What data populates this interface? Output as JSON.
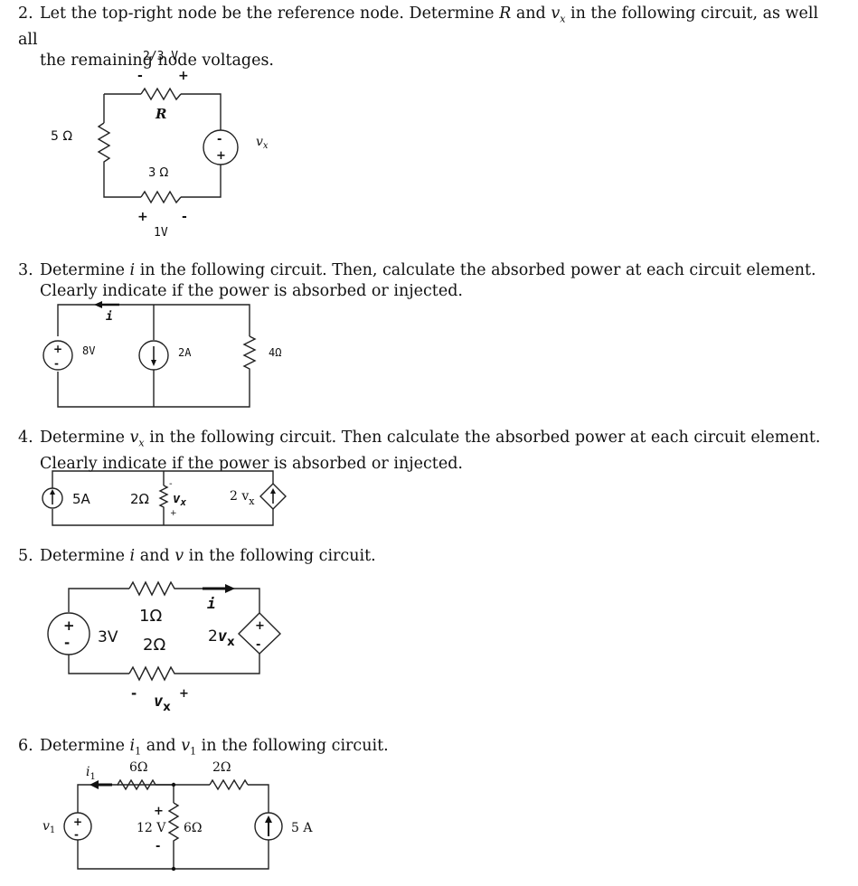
{
  "problems": [
    {
      "number": "2.",
      "line1_a": "Let the top-right node be the reference node. Determine ",
      "line1_R": "R",
      "line1_b": " and ",
      "line1_vx": "v",
      "line1_vx_sub": "x",
      "line1_c": " in the following circuit, as well all",
      "line2": "the remaining node voltages.",
      "circuit": {
        "top_voltage": "2/3 V",
        "top_minus": "-",
        "top_plus": "+",
        "resistor_R": "R",
        "left_resistor": "5 Ω",
        "bottom_resistor": "3 Ω",
        "source_label": "v",
        "source_label_sub": "x",
        "source_top_sign": "-",
        "source_bottom_sign": "+",
        "bottom_plus": "+",
        "bottom_minus": "-",
        "bottom_voltage": "1V"
      }
    },
    {
      "number": "3.",
      "line1_a": "Determine ",
      "line1_i": "i",
      "line1_b": " in the following circuit.  Then, calculate the absorbed power at each circuit element.",
      "line2": "Clearly indicate if the power is absorbed or injected.",
      "circuit": {
        "current_label": "i",
        "voltage_source": "8V",
        "vs_plus": "+",
        "vs_minus": "-",
        "current_source": "2A",
        "resistor": "4Ω"
      }
    },
    {
      "number": "4.",
      "line1_a": "Determine ",
      "line1_vx": "v",
      "line1_vx_sub": "x",
      "line1_b": " in the following circuit.  Then calculate the absorbed power at each circuit element.",
      "line2": "Clearly indicate if the power is absorbed or injected.",
      "circuit": {
        "current_source": "5A",
        "resistor": "2Ω",
        "vx_label": "v",
        "vx_sub": "x",
        "vx_minus": "-",
        "vx_plus": "+",
        "dep_source": "2 v",
        "dep_source_sub": "x"
      }
    },
    {
      "number": "5.",
      "line1_a": "Determine ",
      "line1_i": "i",
      "line1_b": " and ",
      "line1_v": "v",
      "line1_c": " in the following circuit.",
      "circuit": {
        "voltage_source": "3V",
        "vs_plus": "+",
        "vs_minus": "-",
        "top_resistor": "1Ω",
        "bottom_resistor": "2Ω",
        "current_label": "i",
        "dep_source": "2",
        "dep_source_v": "v",
        "dep_source_sub": "x",
        "dep_plus": "+",
        "dep_minus": "-",
        "vx_minus": "-",
        "vx_plus": "+",
        "vx_label": "v",
        "vx_sub": "x"
      }
    },
    {
      "number": "6.",
      "line1_a": "Determine ",
      "line1_i": "i",
      "line1_i_sub": "1",
      "line1_b": " and ",
      "line1_v": "v",
      "line1_v_sub": "1",
      "line1_c": " in the following circuit.",
      "circuit": {
        "current_label": "i",
        "current_sub": "1",
        "top_left_resistor": "6Ω",
        "top_right_resistor": "2Ω",
        "source_label": "v",
        "source_sub": "1",
        "vs_plus": "+",
        "vs_minus": "-",
        "middle_voltage": "12 V",
        "mid_plus": "+",
        "mid_minus": "-",
        "middle_resistor": "6Ω",
        "current_source": "5 A"
      }
    }
  ]
}
